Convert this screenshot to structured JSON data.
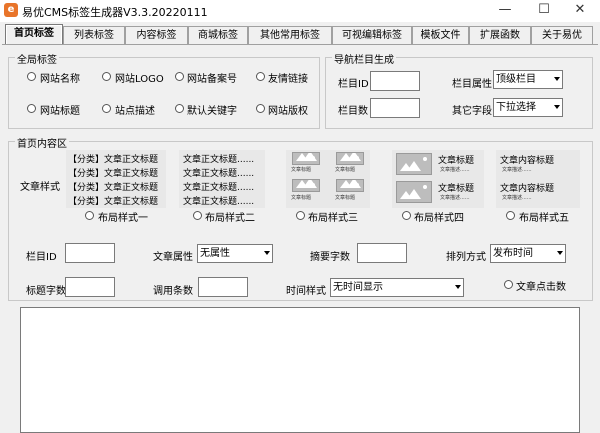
{
  "window": {
    "title": "易优CMS标签生成器V3.3.20220111",
    "app_icon": "e",
    "minimize": "—",
    "maximize": "☐",
    "close": "✕"
  },
  "tabs": [
    "首页标签",
    "列表标签",
    "内容标签",
    "商城标签",
    "其他常用标签",
    "可视编辑标签",
    "模板文件",
    "扩展函数",
    "关于易优"
  ],
  "global_tags": {
    "title": "全局标签",
    "options": [
      "网站名称",
      "网站LOGO",
      "网站备案号",
      "友情链接",
      "网站标题",
      "站点描述",
      "默认关键字",
      "网站版权"
    ]
  },
  "nav_gen": {
    "title": "导航栏目生成",
    "column_id_label": "栏目ID",
    "column_count_label": "栏目数",
    "column_attr_label": "栏目属性",
    "column_attr_value": "顶级栏目",
    "other_field_label": "其它字段",
    "other_field_value": "下拉选择"
  },
  "home_content": {
    "title": "首页内容区",
    "article_style_label": "文章样式",
    "layout1": {
      "lines": [
        "【分类】文章正文标题",
        "【分类】文章正文标题",
        "【分类】文章正文标题",
        "【分类】文章正文标题"
      ],
      "radio": "布局样式一"
    },
    "layout2": {
      "lines": [
        "文章正文标题......",
        "文章正文标题......",
        "文章正文标题......",
        "文章正文标题......"
      ],
      "radio": "布局样式二"
    },
    "layout3": {
      "caption": "文章标题",
      "radio": "布局样式三"
    },
    "layout4": {
      "title": "文章标题",
      "desc": "文章描述......",
      "radio": "布局样式四"
    },
    "layout5": {
      "title": "文章内容标题",
      "desc": "文章描述......",
      "radio": "布局样式五"
    },
    "fields": {
      "column_id": "栏目ID",
      "article_attr": "文章属性",
      "article_attr_value": "无属性",
      "summary_chars": "摘要字数",
      "sort_method": "排列方式",
      "sort_value": "发布时间",
      "title_chars": "标题字数",
      "call_count": "调用条数",
      "time_style": "时间样式",
      "time_value": "无时间显示",
      "article_clicks": "文章点击数"
    }
  }
}
